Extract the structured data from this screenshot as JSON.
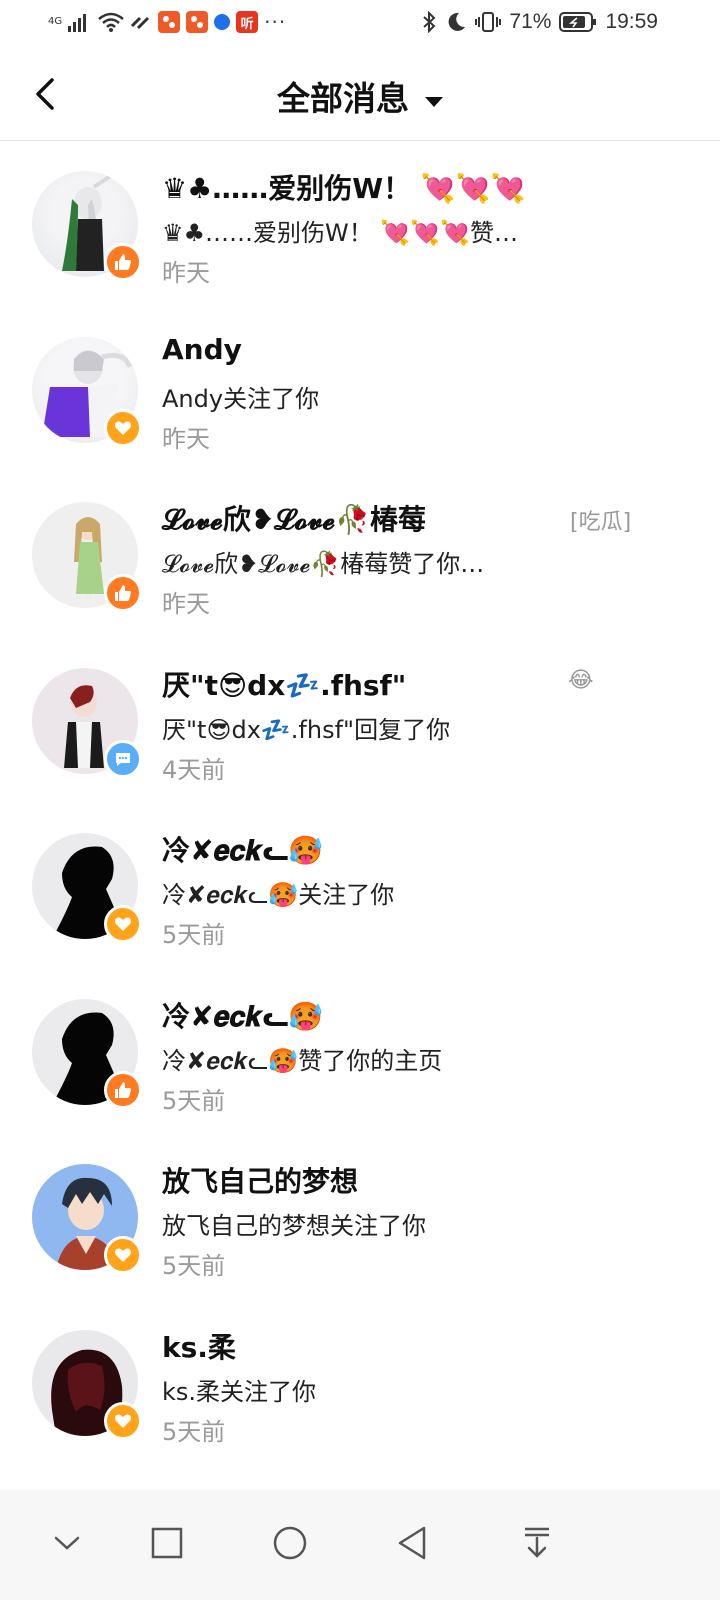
{
  "status_bar": {
    "network": "4G",
    "battery": "71%",
    "time": "19:59",
    "dots": "···",
    "app_icon_listen": "听"
  },
  "header": {
    "title": "全部消息"
  },
  "messages": [
    {
      "name": "♛♣……爱别伤W！ 💘💘💘",
      "text": "♛♣……爱别伤W！ 💘💘💘赞…",
      "time": "昨天",
      "badge": "like-icon",
      "extra": ""
    },
    {
      "name": "Andy",
      "text": "Andy关注了你",
      "time": "昨天",
      "badge": "heart-icon",
      "extra": ""
    },
    {
      "name": "𝓛𝓸𝓿𝓮欣❥𝓛𝓸𝓿𝓮🥀椿莓",
      "text": "𝓛𝓸𝓿𝓮欣❥𝓛𝓸𝓿𝓮🥀椿莓赞了你…",
      "time": "昨天",
      "badge": "like-icon",
      "extra": "[吃瓜]"
    },
    {
      "name": "厌\"t😎dx💤.fhsf\"",
      "text": "厌\"t😎dx💤.fhsf\"回复了你",
      "time": "4天前",
      "badge": "comment-icon",
      "extra": "😂"
    },
    {
      "name": "冷✘𝒆𝒄𝒌ᓚ🥵",
      "text": "冷✘𝒆𝒄𝒌ᓚ🥵关注了你",
      "time": "5天前",
      "badge": "heart-icon",
      "extra": ""
    },
    {
      "name": "冷✘𝒆𝒄𝒌ᓚ🥵",
      "text": "冷✘𝒆𝒄𝒌ᓚ🥵赞了你的主页",
      "time": "5天前",
      "badge": "like-icon",
      "extra": ""
    },
    {
      "name": "放飞自己的梦想",
      "text": "放飞自己的梦想关注了你",
      "time": "5天前",
      "badge": "heart-icon",
      "extra": ""
    },
    {
      "name": "ks.柔",
      "text": "ks.柔关注了你",
      "time": "5天前",
      "badge": "heart-icon",
      "extra": ""
    }
  ],
  "colors": {
    "like_badge": "#ff7a21",
    "follow_badge": "#ffa31a",
    "reply_badge": "#5aaef7",
    "time_text": "#9a9a9a"
  },
  "navbar": {
    "buttons": [
      "collapse-icon",
      "recents-icon",
      "home-icon",
      "back-icon",
      "notification-pull-icon"
    ]
  }
}
